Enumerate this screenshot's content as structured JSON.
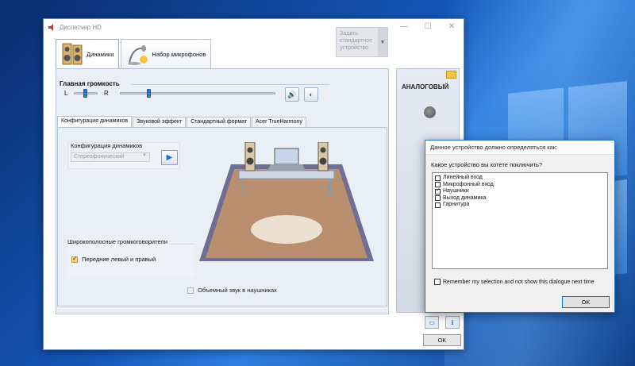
{
  "window": {
    "title": "Диспетчер HD",
    "controls": [
      "—",
      "☐",
      "✕"
    ]
  },
  "device_tabs": [
    {
      "label": "Динамики",
      "icon": "speaker-icon",
      "active": true
    },
    {
      "label": "Набор микрофонов",
      "icon": "microphone-icon",
      "active": false
    }
  ],
  "main_volume": {
    "label": "Главная громкость",
    "left_label": "L",
    "right_label": "R",
    "balance": 0.5,
    "level": 0.2,
    "mute_icon": "speaker-volume-icon",
    "settings_icon": "volume-settings-icon"
  },
  "default_device_button": "Задать стандартное устройство",
  "sub_tabs": [
    {
      "label": "Конфигурация динамиков",
      "active": true
    },
    {
      "label": "Звуковой эффект",
      "active": false
    },
    {
      "label": "Стандартный формат",
      "active": false
    },
    {
      "label": "Acer TrueHarmony",
      "active": false
    }
  ],
  "speaker_config": {
    "label": "Конфигурация динамиков",
    "selected": "Стереофонический",
    "play_icon": "play-icon"
  },
  "wideband": {
    "label": "Широкополосные громкоговорители",
    "option": "Передние левый и правый",
    "checked": true
  },
  "surround_headphones": {
    "label": "Объемный звук в наушниках",
    "checked": false
  },
  "side_panel": {
    "label": "АНАЛОГОВЫЙ",
    "folder_icon": "folder-icon",
    "jack_icon": "audio-jack-icon"
  },
  "bottom_icons": [
    "info-icon",
    "information-icon"
  ],
  "ok_label": "OK",
  "dialog": {
    "title": "Данное устройство должно определяться как:",
    "question": "Какое устройство вы хотете поключить?",
    "options": [
      {
        "label": "Линейный вход",
        "checked": false
      },
      {
        "label": "Микрофонный вход",
        "checked": false
      },
      {
        "label": "Наушники",
        "checked": true
      },
      {
        "label": "Выход динамика",
        "checked": false
      },
      {
        "label": "Гарнитура",
        "checked": false
      }
    ],
    "remember": "Remember my selection and not show this dialogue next time",
    "ok_label": "OK"
  }
}
